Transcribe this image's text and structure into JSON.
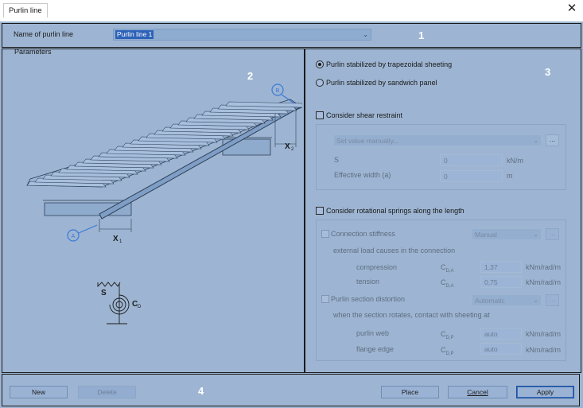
{
  "window": {
    "title": "Purlin line",
    "close_glyph": "✕"
  },
  "badges": [
    "1",
    "2",
    "3",
    "4"
  ],
  "name_row": {
    "label": "Name of purlin line",
    "value": "Purlin line 1"
  },
  "parameters": {
    "label": "Parameters",
    "figure": {
      "point_a": "A",
      "point_b": "B",
      "x1": "X",
      "x1_sub": "1",
      "x2": "X",
      "x2_sub": "2",
      "s_label": "S",
      "cd_label": "C",
      "cd_sub": "D"
    }
  },
  "stabilization": {
    "option_trapezoidal": "Purlin stabilized by trapezoidal sheeting",
    "option_sandwich": "Purlin stabilized by sandwich panel",
    "selected": "trapezoidal"
  },
  "shear": {
    "checkbox_label": "Consider shear restraint",
    "mode_value": "Set value manually...",
    "more_label": "...",
    "s_label": "S",
    "s_value": "0",
    "s_unit": "kN/m",
    "width_label": "Effective width (a)",
    "width_value": "0",
    "width_unit": "m"
  },
  "rotational": {
    "checkbox_label": "Consider rotational springs along the length",
    "connection_label": "Connection stiffness",
    "connection_mode": "Manual",
    "more_label": "...",
    "external_load_text": "external load causes in the connection",
    "compression_label": "compression",
    "compression_sym": "C",
    "compression_sub": "D,A",
    "compression_value": "1,37",
    "compression_unit": "kNm/rad/m",
    "tension_label": "tension",
    "tension_sym": "C",
    "tension_sub": "D,A",
    "tension_value": "0,75",
    "tension_unit": "kNm/rad/m",
    "distortion_label": "Purlin section distortion",
    "distortion_mode": "Automatic",
    "rotation_text": "when the section rotates, contact with sheeting at",
    "web_label": "purlin web",
    "web_sym": "C",
    "web_sub": "D,P",
    "web_value": "auto",
    "web_unit": "kNm/rad/m",
    "flange_label": "flange edge",
    "flange_sym": "C",
    "flange_sub": "D,P",
    "flange_value": "auto",
    "flange_unit": "kNm/rad/m"
  },
  "buttons": {
    "new": "New",
    "delete": "Delete",
    "place": "Place",
    "cancel": "Cancel",
    "apply": "Apply"
  },
  "colors": {
    "overlay": "#608abc",
    "accent": "#3c78d8",
    "badge_text": "#ffffff"
  }
}
